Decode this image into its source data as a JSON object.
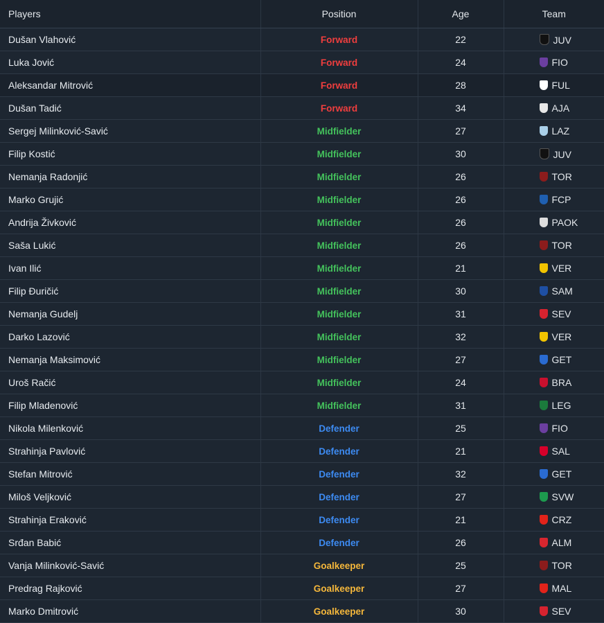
{
  "headers": {
    "players": "Players",
    "position": "Position",
    "age": "Age",
    "team": "Team"
  },
  "position_colors": {
    "Forward": "#f03e3e",
    "Midfielder": "#44c25c",
    "Defender": "#3d8bf2",
    "Goalkeeper": "#f5b73b"
  },
  "rows": [
    {
      "name": "Dušan Vlahović",
      "position": "Forward",
      "age": "22",
      "team": "JUV",
      "crest_icon": "juventus-crest-icon",
      "crest_color": "#111111"
    },
    {
      "name": "Luka Jović",
      "position": "Forward",
      "age": "24",
      "team": "FIO",
      "crest_icon": "fiorentina-crest-icon",
      "crest_color": "#6b3fa0"
    },
    {
      "name": "Aleksandar Mitrović",
      "position": "Forward",
      "age": "28",
      "team": "FUL",
      "crest_icon": "fulham-crest-icon",
      "crest_color": "#ffffff"
    },
    {
      "name": "Dušan Tadić",
      "position": "Forward",
      "age": "34",
      "team": "AJA",
      "crest_icon": "ajax-crest-icon",
      "crest_color": "#e8e8e8"
    },
    {
      "name": "Sergej Milinković-Savić",
      "position": "Midfielder",
      "age": "27",
      "team": "LAZ",
      "crest_icon": "lazio-crest-icon",
      "crest_color": "#a9cfe8"
    },
    {
      "name": "Filip Kostić",
      "position": "Midfielder",
      "age": "30",
      "team": "JUV",
      "crest_icon": "juventus-crest-icon",
      "crest_color": "#111111"
    },
    {
      "name": "Nemanja Radonjić",
      "position": "Midfielder",
      "age": "26",
      "team": "TOR",
      "crest_icon": "torino-crest-icon",
      "crest_color": "#8b1c1c"
    },
    {
      "name": "Marko Grujić",
      "position": "Midfielder",
      "age": "26",
      "team": "FCP",
      "crest_icon": "porto-crest-icon",
      "crest_color": "#1f5fb0"
    },
    {
      "name": "Andrija Živković",
      "position": "Midfielder",
      "age": "26",
      "team": "PAOK",
      "crest_icon": "paok-crest-icon",
      "crest_color": "#dddddd"
    },
    {
      "name": "Saša Lukić",
      "position": "Midfielder",
      "age": "26",
      "team": "TOR",
      "crest_icon": "torino-crest-icon",
      "crest_color": "#8b1c1c"
    },
    {
      "name": "Ivan Ilić",
      "position": "Midfielder",
      "age": "21",
      "team": "VER",
      "crest_icon": "verona-crest-icon",
      "crest_color": "#f2c400"
    },
    {
      "name": "Filip Đuričić",
      "position": "Midfielder",
      "age": "30",
      "team": "SAM",
      "crest_icon": "sampdoria-crest-icon",
      "crest_color": "#1e4fa3"
    },
    {
      "name": "Nemanja Gudelj",
      "position": "Midfielder",
      "age": "31",
      "team": "SEV",
      "crest_icon": "sevilla-crest-icon",
      "crest_color": "#d7232f"
    },
    {
      "name": "Darko Lazović",
      "position": "Midfielder",
      "age": "32",
      "team": "VER",
      "crest_icon": "verona-crest-icon",
      "crest_color": "#f2c400"
    },
    {
      "name": "Nemanja Maksimović",
      "position": "Midfielder",
      "age": "27",
      "team": "GET",
      "crest_icon": "getafe-crest-icon",
      "crest_color": "#2a6bd1"
    },
    {
      "name": "Uroš Račić",
      "position": "Midfielder",
      "age": "24",
      "team": "BRA",
      "crest_icon": "braga-crest-icon",
      "crest_color": "#c8102e"
    },
    {
      "name": "Filip Mladenović",
      "position": "Midfielder",
      "age": "31",
      "team": "LEG",
      "crest_icon": "legia-crest-icon",
      "crest_color": "#1b7a3c"
    },
    {
      "name": "Nikola Milenković",
      "position": "Defender",
      "age": "25",
      "team": "FIO",
      "crest_icon": "fiorentina-crest-icon",
      "crest_color": "#6b3fa0"
    },
    {
      "name": "Strahinja Pavlović",
      "position": "Defender",
      "age": "21",
      "team": "SAL",
      "crest_icon": "salzburg-crest-icon",
      "crest_color": "#d6002a"
    },
    {
      "name": "Stefan Mitrović",
      "position": "Defender",
      "age": "32",
      "team": "GET",
      "crest_icon": "getafe-crest-icon",
      "crest_color": "#2a6bd1"
    },
    {
      "name": "Miloš Veljković",
      "position": "Defender",
      "age": "27",
      "team": "SVW",
      "crest_icon": "werder-crest-icon",
      "crest_color": "#1d9a4e"
    },
    {
      "name": "Strahinja Eraković",
      "position": "Defender",
      "age": "21",
      "team": "CRZ",
      "crest_icon": "crvena-zvezda-crest-icon",
      "crest_color": "#e2231a"
    },
    {
      "name": "Srđan Babić",
      "position": "Defender",
      "age": "26",
      "team": "ALM",
      "crest_icon": "almeria-crest-icon",
      "crest_color": "#d8262f"
    },
    {
      "name": "Vanja Milinković-Savić",
      "position": "Goalkeeper",
      "age": "25",
      "team": "TOR",
      "crest_icon": "torino-crest-icon",
      "crest_color": "#8b1c1c"
    },
    {
      "name": "Predrag Rajković",
      "position": "Goalkeeper",
      "age": "27",
      "team": "MAL",
      "crest_icon": "mallorca-crest-icon",
      "crest_color": "#e2231a"
    },
    {
      "name": "Marko Dmitrović",
      "position": "Goalkeeper",
      "age": "30",
      "team": "SEV",
      "crest_icon": "sevilla-crest-icon",
      "crest_color": "#d7232f"
    }
  ]
}
